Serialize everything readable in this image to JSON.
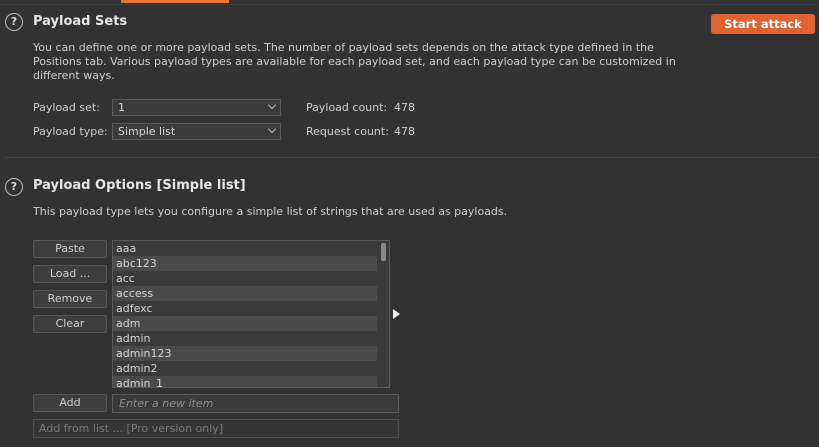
{
  "header": {
    "start_attack_label": "Start attack"
  },
  "payload_sets": {
    "title": "Payload Sets",
    "description": "You can define one or more payload sets. The number of payload sets depends on the attack type defined in the Positions tab. Various payload types are available for each payload set, and each payload type can be customized in different ways.",
    "payload_set_label": "Payload set:",
    "payload_set_value": "1",
    "payload_type_label": "Payload type:",
    "payload_type_value": "Simple list",
    "payload_count_label": "Payload count:",
    "payload_count_value": "478",
    "request_count_label": "Request count:",
    "request_count_value": "478"
  },
  "payload_options": {
    "title": "Payload Options [Simple list]",
    "description": "This payload type lets you configure a simple list of strings that are used as payloads.",
    "buttons": {
      "paste": "Paste",
      "load": "Load ...",
      "remove": "Remove",
      "clear": "Clear",
      "add": "Add"
    },
    "items": [
      "aaa",
      "abc123",
      "acc",
      "access",
      "adfexc",
      "adm",
      "admin",
      "admin123",
      "admin2",
      "admin_1"
    ],
    "new_item_placeholder": "Enter a new item",
    "add_from_list_value": "Add from list ... [Pro version only]"
  },
  "colors": {
    "accent": "#e2632f",
    "background": "#323232",
    "list_alt_row": "#4a4a4a"
  },
  "icons": {
    "help": "help-icon",
    "dropdown": "chevron-down-icon"
  }
}
